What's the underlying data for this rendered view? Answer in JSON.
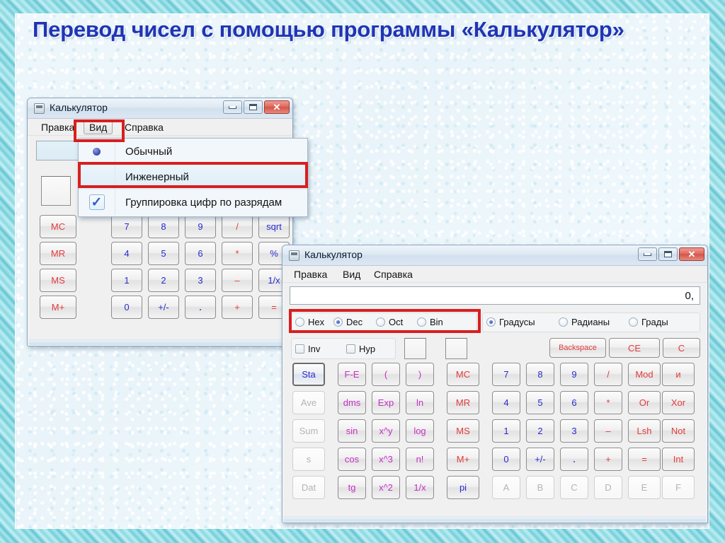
{
  "slide": {
    "title": "Перевод чисел с помощью программы «Калькулятор»",
    "accent_color": "#1f35b4",
    "border_color": "#8fdbe4",
    "background_color": "#eaf6fb",
    "annotation_color": "#d81f1f"
  },
  "window_standard": {
    "title": "Калькулятор",
    "icon": "calculator-icon",
    "window_buttons": [
      {
        "name": "minimize-button",
        "glyph": "minimize-icon"
      },
      {
        "name": "maximize-button",
        "glyph": "maximize-icon"
      },
      {
        "name": "close-button",
        "glyph": "close-icon",
        "label": "✕"
      }
    ],
    "menu": [
      {
        "label": "Правка",
        "state": "normal"
      },
      {
        "label": "Вид",
        "state": "pressed"
      },
      {
        "label": "Справка",
        "state": "normal"
      }
    ],
    "display_value": "",
    "view_menu": {
      "items": [
        {
          "label": "Обычный",
          "marker": "radio-selected",
          "highlighted": false
        },
        {
          "label": "Инженерный",
          "marker": "none",
          "highlighted": true
        },
        {
          "label": "Группировка цифр по разрядам",
          "marker": "check",
          "highlighted": false
        }
      ]
    },
    "memory_keys": [
      "MC",
      "MR",
      "MS",
      "M+"
    ],
    "keypad_rows": [
      [
        {
          "label": "7",
          "kind": "digit"
        },
        {
          "label": "8",
          "kind": "digit"
        },
        {
          "label": "9",
          "kind": "digit"
        },
        {
          "label": "/",
          "kind": "op"
        },
        {
          "label": "sqrt",
          "kind": "digit"
        }
      ],
      [
        {
          "label": "4",
          "kind": "digit"
        },
        {
          "label": "5",
          "kind": "digit"
        },
        {
          "label": "6",
          "kind": "digit"
        },
        {
          "label": "*",
          "kind": "op"
        },
        {
          "label": "%",
          "kind": "digit"
        }
      ],
      [
        {
          "label": "1",
          "kind": "digit"
        },
        {
          "label": "2",
          "kind": "digit"
        },
        {
          "label": "3",
          "kind": "digit"
        },
        {
          "label": "–",
          "kind": "op"
        },
        {
          "label": "1/x",
          "kind": "digit"
        }
      ],
      [
        {
          "label": "0",
          "kind": "digit"
        },
        {
          "label": "+/-",
          "kind": "digit"
        },
        {
          "label": ".",
          "kind": "dot"
        },
        {
          "label": "+",
          "kind": "op"
        },
        {
          "label": "=",
          "kind": "op"
        }
      ]
    ]
  },
  "window_scientific": {
    "title": "Калькулятор",
    "icon": "calculator-icon",
    "window_buttons": [
      {
        "name": "minimize-button",
        "glyph": "minimize-icon"
      },
      {
        "name": "maximize-button",
        "glyph": "maximize-icon"
      },
      {
        "name": "close-button",
        "glyph": "close-icon",
        "label": "✕"
      }
    ],
    "menu": [
      {
        "label": "Правка"
      },
      {
        "label": "Вид"
      },
      {
        "label": "Справка"
      }
    ],
    "display_value": "0,",
    "base_radios": [
      {
        "label": "Hex",
        "selected": false
      },
      {
        "label": "Dec",
        "selected": true
      },
      {
        "label": "Oct",
        "selected": false
      },
      {
        "label": "Bin",
        "selected": false
      }
    ],
    "angle_radios": [
      {
        "label": "Градусы",
        "selected": true
      },
      {
        "label": "Радианы",
        "selected": false
      },
      {
        "label": "Грады",
        "selected": false
      }
    ],
    "modifiers": [
      {
        "label": "Inv",
        "checked": false
      },
      {
        "label": "Hyp",
        "checked": false
      }
    ],
    "clear_keys": [
      {
        "label": "Backspace",
        "kind": "op"
      },
      {
        "label": "CE",
        "kind": "op"
      },
      {
        "label": "C",
        "kind": "op"
      }
    ],
    "stat_column": [
      {
        "label": "Sta",
        "kind": "digit",
        "selected": true
      },
      {
        "label": "Ave",
        "kind": "dis"
      },
      {
        "label": "Sum",
        "kind": "dis"
      },
      {
        "label": "s",
        "kind": "dis"
      },
      {
        "label": "Dat",
        "kind": "dis"
      }
    ],
    "sci_rows": [
      [
        {
          "label": "F-E",
          "kind": "sci"
        },
        {
          "label": "(",
          "kind": "sci"
        },
        {
          "label": ")",
          "kind": "sci"
        }
      ],
      [
        {
          "label": "dms",
          "kind": "sci"
        },
        {
          "label": "Exp",
          "kind": "sci"
        },
        {
          "label": "ln",
          "kind": "sci"
        }
      ],
      [
        {
          "label": "sin",
          "kind": "sci"
        },
        {
          "label": "x^y",
          "kind": "sci"
        },
        {
          "label": "log",
          "kind": "sci"
        }
      ],
      [
        {
          "label": "cos",
          "kind": "sci"
        },
        {
          "label": "x^3",
          "kind": "sci"
        },
        {
          "label": "n!",
          "kind": "sci"
        }
      ],
      [
        {
          "label": "tg",
          "kind": "sci"
        },
        {
          "label": "x^2",
          "kind": "sci"
        },
        {
          "label": "1/x",
          "kind": "sci"
        }
      ]
    ],
    "memory_column": [
      {
        "label": "MC",
        "kind": "mem"
      },
      {
        "label": "MR",
        "kind": "mem"
      },
      {
        "label": "MS",
        "kind": "mem"
      },
      {
        "label": "M+",
        "kind": "mem"
      },
      {
        "label": "pi",
        "kind": "digit"
      }
    ],
    "main_rows": [
      [
        {
          "label": "7",
          "kind": "digit"
        },
        {
          "label": "8",
          "kind": "digit"
        },
        {
          "label": "9",
          "kind": "digit"
        },
        {
          "label": "/",
          "kind": "op"
        },
        {
          "label": "Mod",
          "kind": "op"
        },
        {
          "label": "и",
          "kind": "op"
        }
      ],
      [
        {
          "label": "4",
          "kind": "digit"
        },
        {
          "label": "5",
          "kind": "digit"
        },
        {
          "label": "6",
          "kind": "digit"
        },
        {
          "label": "*",
          "kind": "op"
        },
        {
          "label": "Or",
          "kind": "op"
        },
        {
          "label": "Xor",
          "kind": "op"
        }
      ],
      [
        {
          "label": "1",
          "kind": "digit"
        },
        {
          "label": "2",
          "kind": "digit"
        },
        {
          "label": "3",
          "kind": "digit"
        },
        {
          "label": "–",
          "kind": "op"
        },
        {
          "label": "Lsh",
          "kind": "op"
        },
        {
          "label": "Not",
          "kind": "op"
        }
      ],
      [
        {
          "label": "0",
          "kind": "digit"
        },
        {
          "label": "+/-",
          "kind": "digit"
        },
        {
          "label": ".",
          "kind": "dot"
        },
        {
          "label": "+",
          "kind": "op"
        },
        {
          "label": "=",
          "kind": "op"
        },
        {
          "label": "Int",
          "kind": "op"
        }
      ],
      [
        {
          "label": "A",
          "kind": "dis"
        },
        {
          "label": "B",
          "kind": "dis"
        },
        {
          "label": "C",
          "kind": "dis"
        },
        {
          "label": "D",
          "kind": "dis"
        },
        {
          "label": "E",
          "kind": "dis"
        },
        {
          "label": "F",
          "kind": "dis"
        }
      ]
    ]
  }
}
